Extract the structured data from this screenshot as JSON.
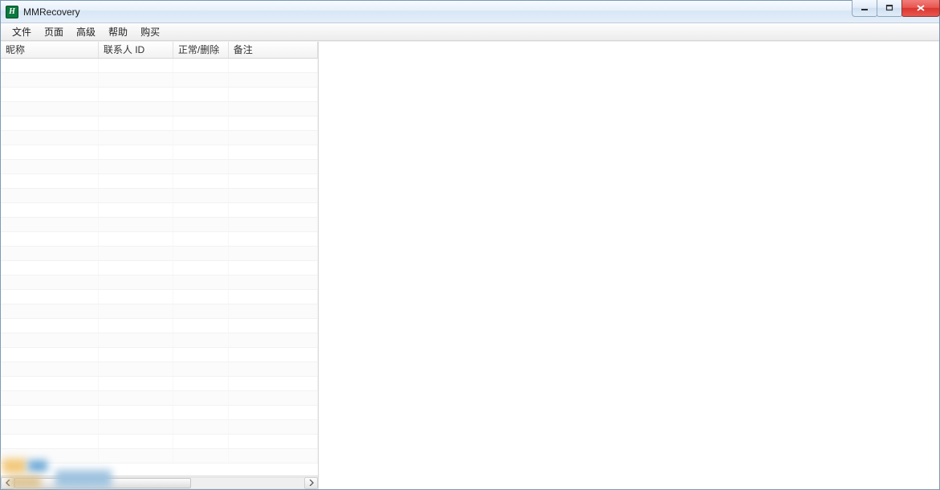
{
  "title": "MMRecovery",
  "icon_letter": "H",
  "menu": {
    "items": [
      {
        "label": "文件"
      },
      {
        "label": "页面"
      },
      {
        "label": "高级"
      },
      {
        "label": "帮助"
      },
      {
        "label": "购买"
      }
    ]
  },
  "table": {
    "columns": [
      {
        "label": "昵称",
        "width": 120
      },
      {
        "label": "联系人 ID",
        "width": 92
      },
      {
        "label": "正常/删除",
        "width": 68
      },
      {
        "label": "备注",
        "width": 110
      }
    ],
    "rows": []
  }
}
